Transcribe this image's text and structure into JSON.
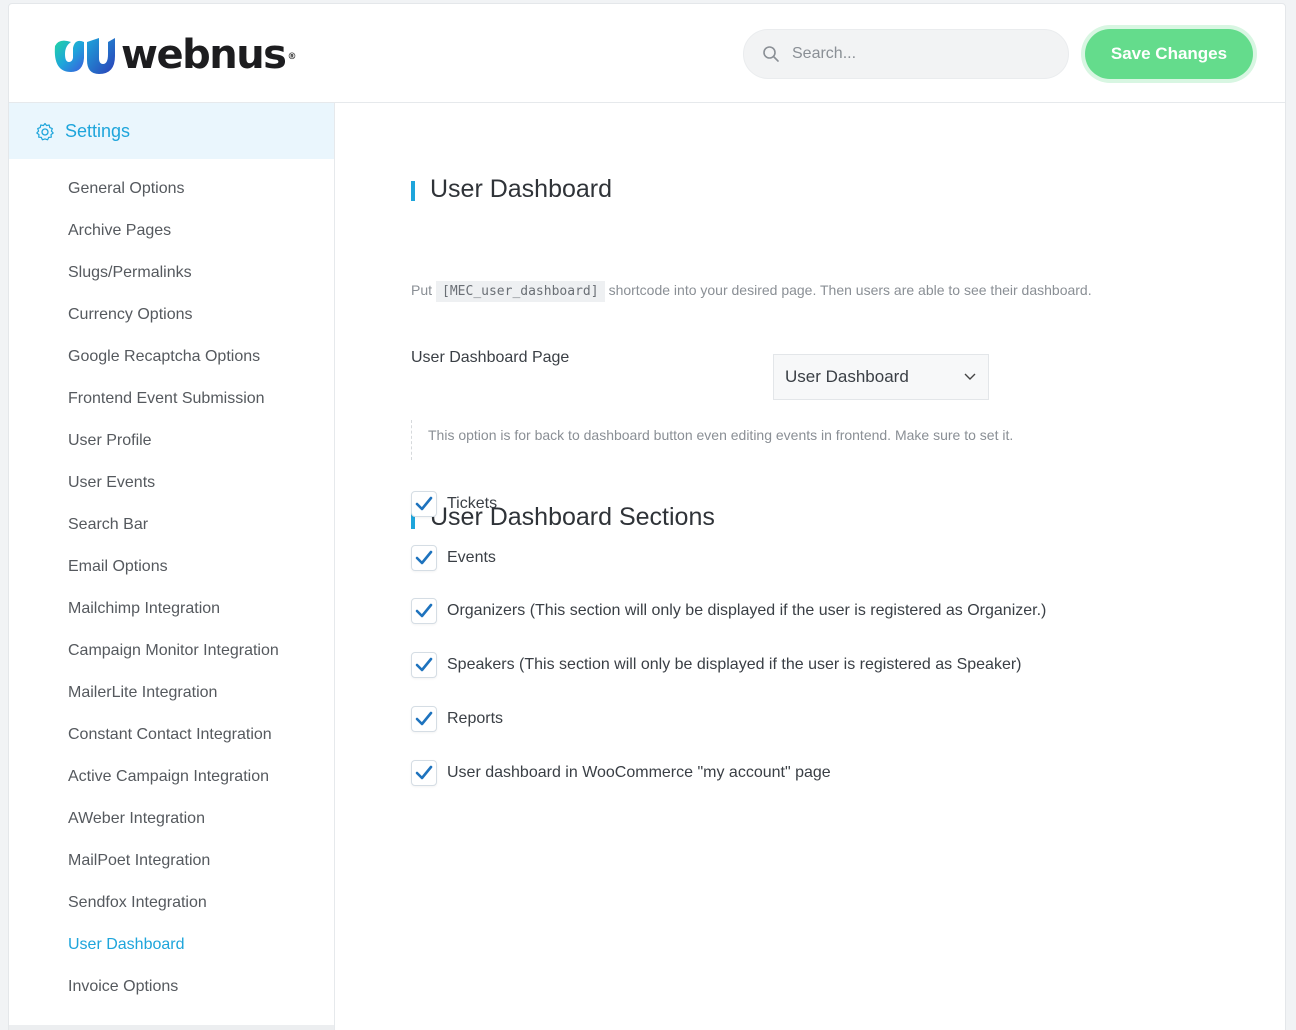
{
  "header": {
    "logo_text": "webnus",
    "logo_reg": "®",
    "search_placeholder": "Search...",
    "save_label": "Save Changes",
    "accent_color": "#64dc8c"
  },
  "sidebar": {
    "title": "Settings",
    "items": [
      {
        "label": "General Options"
      },
      {
        "label": "Archive Pages"
      },
      {
        "label": "Slugs/Permalinks"
      },
      {
        "label": "Currency Options"
      },
      {
        "label": "Google Recaptcha Options"
      },
      {
        "label": "Frontend Event Submission"
      },
      {
        "label": "User Profile"
      },
      {
        "label": "User Events"
      },
      {
        "label": "Search Bar"
      },
      {
        "label": "Email Options"
      },
      {
        "label": "Mailchimp Integration"
      },
      {
        "label": "Campaign Monitor Integration"
      },
      {
        "label": "MailerLite Integration"
      },
      {
        "label": "Constant Contact Integration"
      },
      {
        "label": "Active Campaign Integration"
      },
      {
        "label": "AWeber Integration"
      },
      {
        "label": "MailPoet Integration"
      },
      {
        "label": "Sendfox Integration"
      },
      {
        "label": "User Dashboard",
        "active": true
      },
      {
        "label": "Invoice Options"
      }
    ],
    "active_color": "#1ea5db"
  },
  "main": {
    "section1_title": "User Dashboard",
    "desc_before": "Put",
    "desc_code": "[MEC_user_dashboard]",
    "desc_after": "shortcode into your desired page. Then users are able to see their dashboard.",
    "page_label": "User Dashboard Page",
    "page_select_value": "User Dashboard",
    "page_help": "This option is for back to dashboard button even editing events in frontend. Make sure to set it.",
    "section2_title": "User Dashboard Sections",
    "checkboxes": [
      {
        "label": "Tickets",
        "checked": true
      },
      {
        "label": "Events",
        "checked": true
      },
      {
        "label": "Organizers (This section will only be displayed if the user is registered as Organizer.)",
        "checked": true
      },
      {
        "label": "Speakers (This section will only be displayed if the user is registered as Speaker)",
        "checked": true
      },
      {
        "label": "Reports",
        "checked": true
      },
      {
        "label": "User dashboard in WooCommerce \"my account\" page",
        "checked": true
      }
    ],
    "check_color": "#1e73be"
  }
}
